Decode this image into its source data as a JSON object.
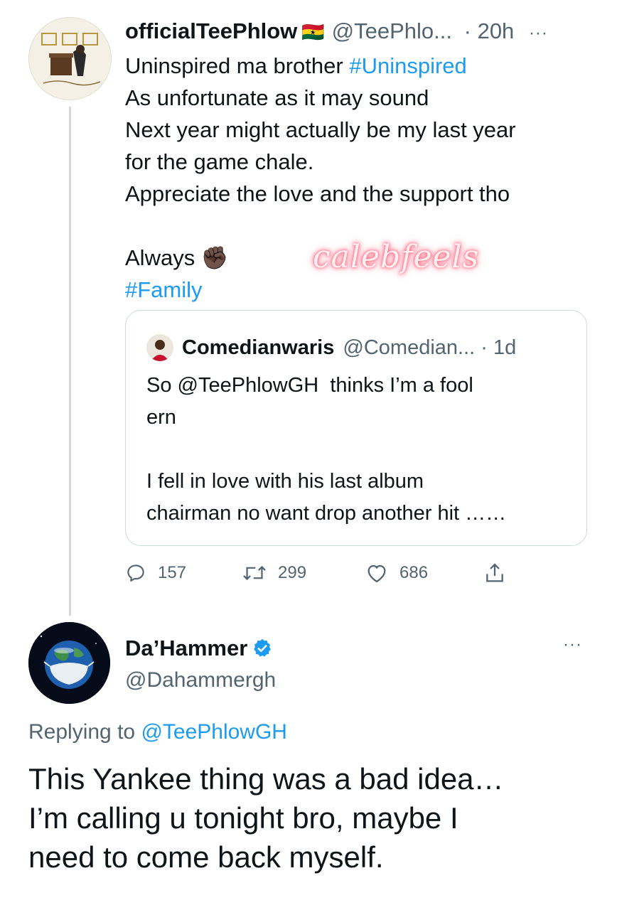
{
  "tweet": {
    "author_name": "officialTeePhlow",
    "flag": "🇬🇭",
    "handle": "@TeePhlo...",
    "time": "· 20h",
    "more": "···",
    "body_lines": [
      {
        "text": "Uninspired ma brother ",
        "hashtag": "#Uninspired"
      },
      {
        "text": "As unfortunate as it may sound"
      },
      {
        "text": "Next year might actually be my last year"
      },
      {
        "text": "for the game chale."
      },
      {
        "text": "Appreciate the love and the support tho"
      },
      {
        "text": ""
      },
      {
        "text": "Always ✊🏿"
      },
      {
        "text": "",
        "hashtag": "#Family"
      }
    ],
    "quoted": {
      "author_name": "Comedianwaris",
      "handle": "@Comedian...",
      "time": "· 1d",
      "body": "So @TeePhlowGH  thinks I’m a fool\nern\n\nI fell in love with his last album\nchairman no want drop another hit ……"
    },
    "actions": {
      "reply_icon": "reply-icon",
      "reply_count": "157",
      "retweet_icon": "retweet-icon",
      "retweet_count": "299",
      "like_icon": "heart-icon",
      "like_count": "686",
      "share_icon": "share-icon"
    }
  },
  "watermark": "calebfeels",
  "reply": {
    "author_name": "Da’Hammer",
    "verified_icon": "verified-badge-icon",
    "handle": "@Dahammergh",
    "more": "···",
    "replying_prefix": "Replying to ",
    "replying_to": "@TeePhlowGH",
    "body": "This Yankee thing was a bad idea…\nI’m calling u tonight bro, maybe I\nneed to come back myself."
  },
  "colors": {
    "link": "#1d9bf0",
    "secondary_text": "#536471",
    "primary_text": "#0f1419",
    "border": "#cfd9de",
    "verified": "#1d9bf0",
    "watermark_glow": "#ff4d6d"
  }
}
